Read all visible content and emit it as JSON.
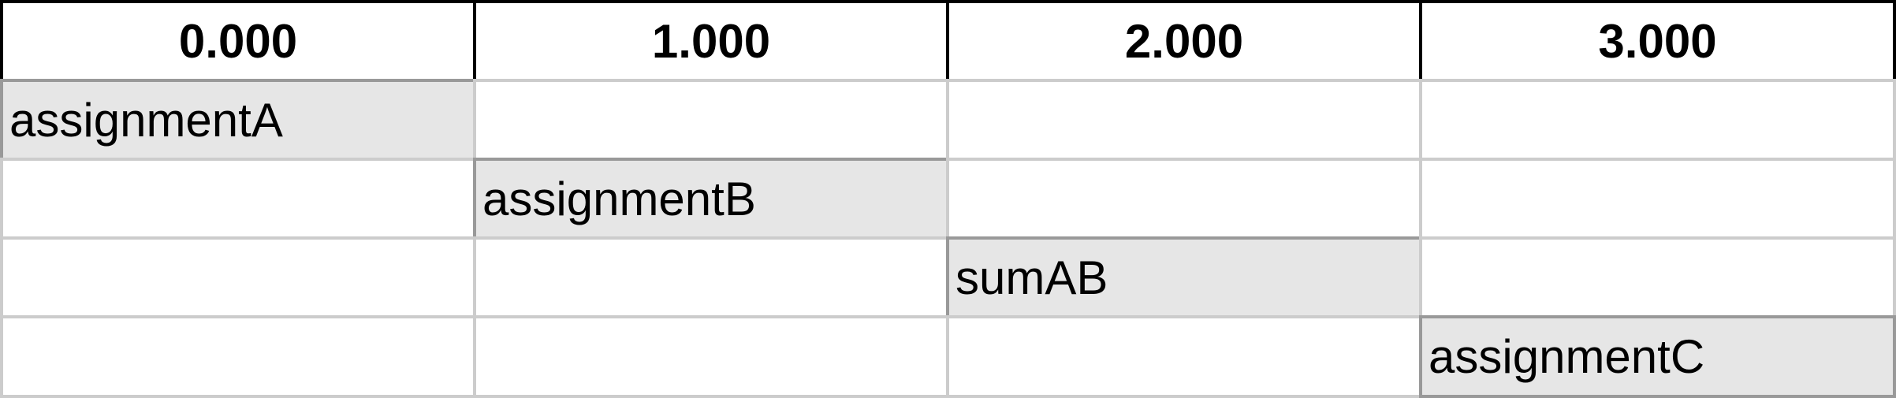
{
  "header": {
    "columns": [
      "0.000",
      "1.000",
      "2.000",
      "3.000"
    ]
  },
  "tasks": [
    {
      "label": "assignmentA",
      "start": 0,
      "row": 1
    },
    {
      "label": "assignmentB",
      "start": 1,
      "row": 2
    },
    {
      "label": "sumAB",
      "start": 2,
      "row": 3
    },
    {
      "label": "assignmentC",
      "start": 3,
      "row": 4
    }
  ],
  "colors": {
    "header_border": "#000000",
    "grid_line": "#cccccc",
    "task_fill": "#e6e6e6",
    "task_border": "#999999"
  }
}
